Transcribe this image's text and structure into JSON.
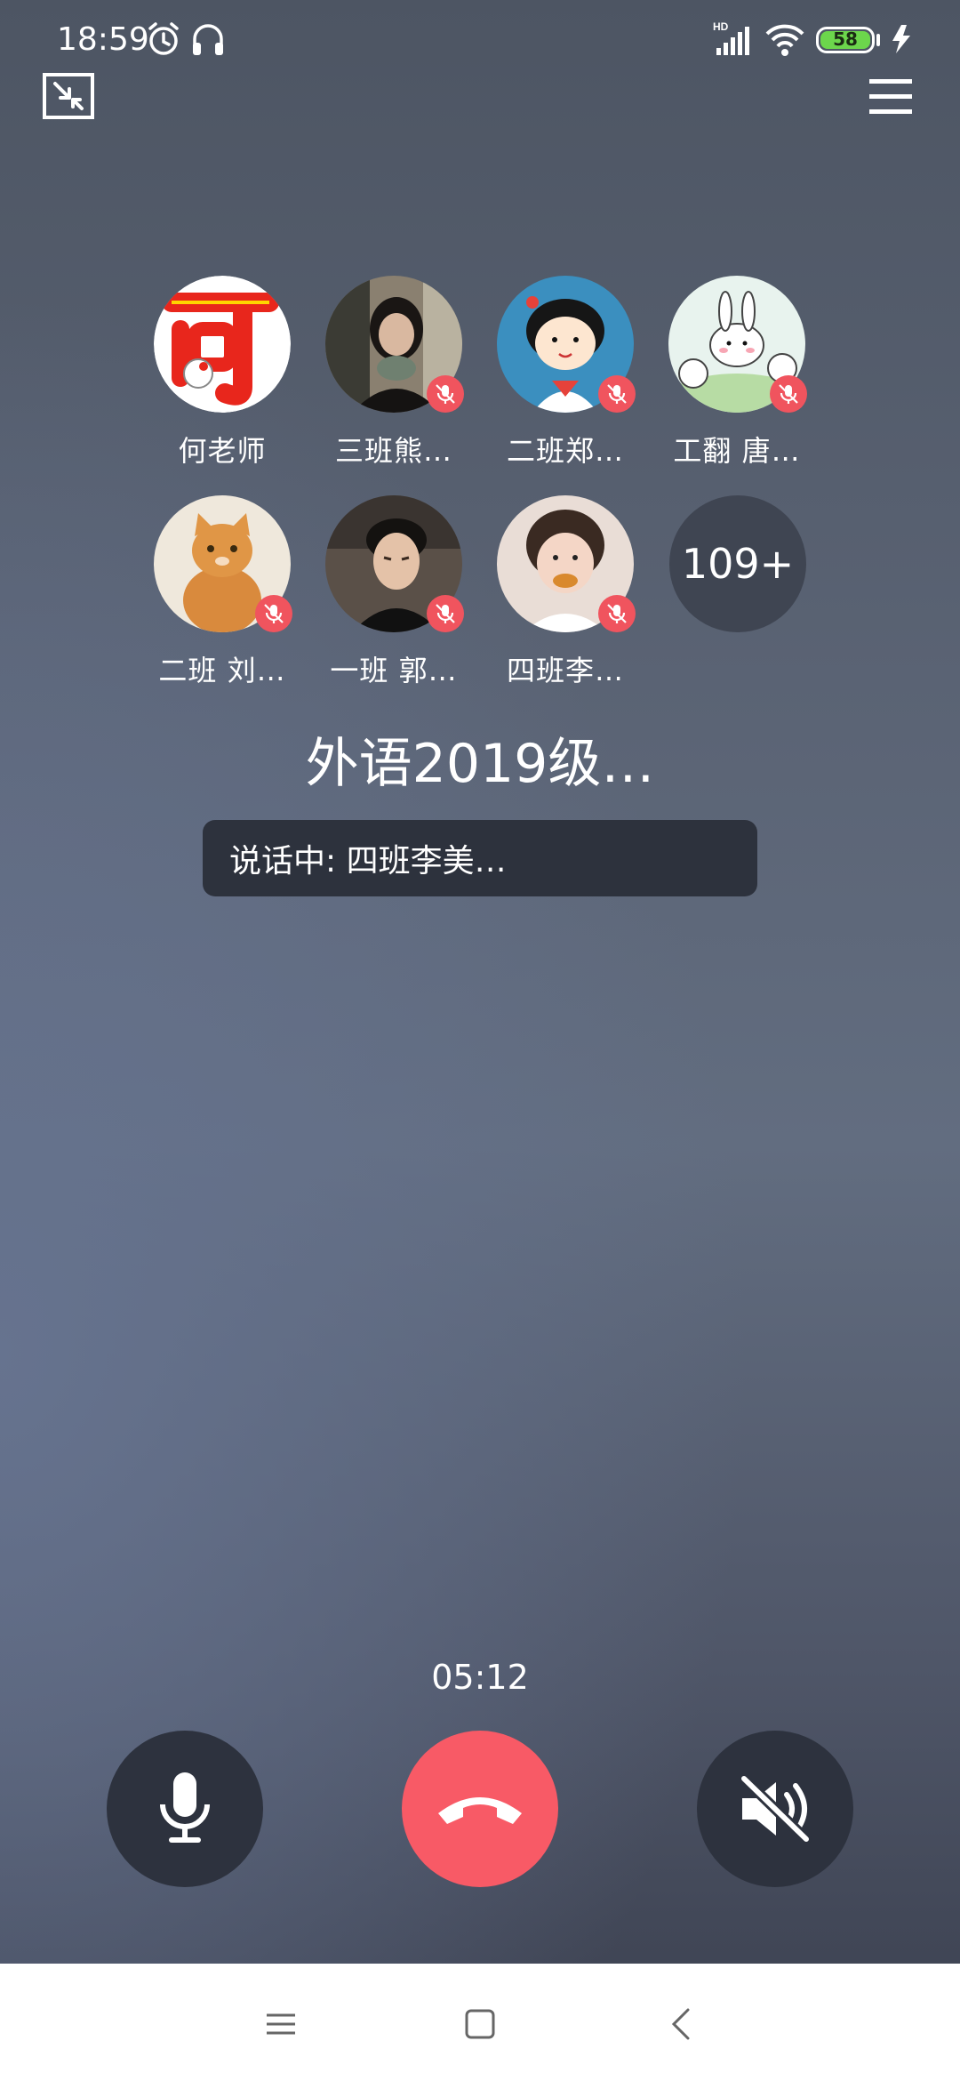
{
  "status_bar": {
    "time": "18:59",
    "battery": "58",
    "icons": [
      "alarm-icon",
      "headphones-icon",
      "signal-hd-icon",
      "wifi-icon",
      "battery-icon",
      "charging-icon"
    ]
  },
  "participants": [
    {
      "name": "何老师",
      "muted": false
    },
    {
      "name": "三班熊…",
      "muted": true
    },
    {
      "name": "二班郑…",
      "muted": true
    },
    {
      "name": "工翻 唐…",
      "muted": true
    },
    {
      "name": "二班 刘…",
      "muted": true
    },
    {
      "name": "一班 郭…",
      "muted": true
    },
    {
      "name": "四班李…",
      "muted": true
    }
  ],
  "more_count": "109+",
  "group_title": "外语2019级…",
  "speaking": "说话中: 四班李美…",
  "call_timer": "05:12",
  "controls": [
    "microphone-icon",
    "hang-up-icon",
    "speaker-mute-icon"
  ],
  "colors": {
    "hangup": "#f85a66",
    "mute_badge": "#f0545e",
    "battery": "#6cd64c"
  }
}
